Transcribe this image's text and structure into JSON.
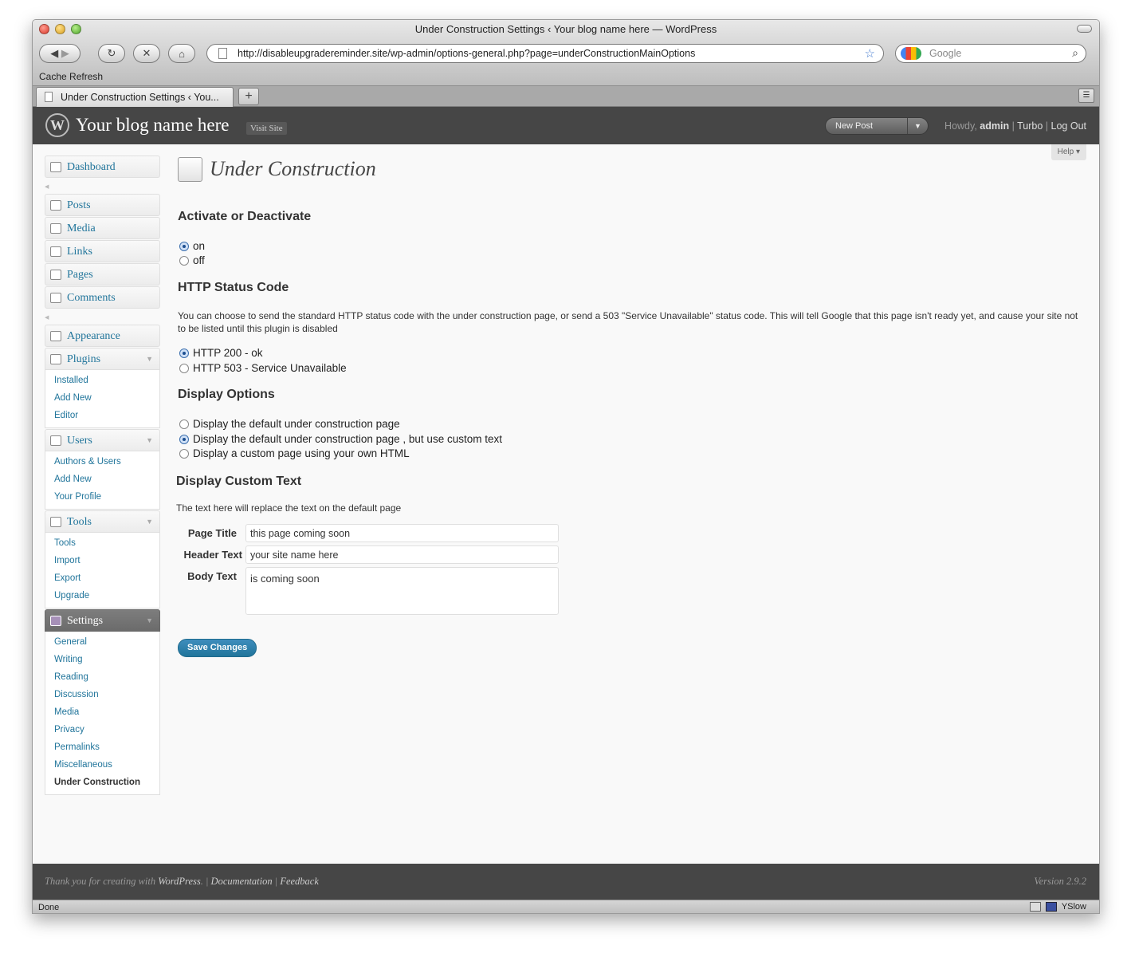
{
  "browser": {
    "window_title": "Under Construction Settings ‹ Your blog name here — WordPress",
    "url": "http://disableupgradereminder.site/wp-admin/options-general.php?page=underConstructionMainOptions",
    "search_placeholder": "Google",
    "bookmark": "Cache Refresh",
    "tab_title": "Under Construction Settings ‹ You...",
    "status": "Done",
    "status_ext": "YSlow"
  },
  "header": {
    "blog_name": "Your blog name here",
    "visit_site": "Visit Site",
    "new_post": "New Post",
    "howdy": "Howdy,",
    "user": "admin",
    "sep1": "|",
    "turbo": "Turbo",
    "sep2": "|",
    "logout": "Log Out",
    "help": "Help"
  },
  "menu": {
    "dashboard": "Dashboard",
    "posts": "Posts",
    "media": "Media",
    "links": "Links",
    "pages": "Pages",
    "comments": "Comments",
    "appearance": "Appearance",
    "plugins": "Plugins",
    "plugins_sub": [
      "Installed",
      "Add New",
      "Editor"
    ],
    "users": "Users",
    "users_sub": [
      "Authors & Users",
      "Add New",
      "Your Profile"
    ],
    "tools": "Tools",
    "tools_sub": [
      "Tools",
      "Import",
      "Export",
      "Upgrade"
    ],
    "settings": "Settings",
    "settings_sub": [
      "General",
      "Writing",
      "Reading",
      "Discussion",
      "Media",
      "Privacy",
      "Permalinks",
      "Miscellaneous",
      "Under Construction"
    ]
  },
  "content": {
    "page_title": "Under Construction",
    "activate_heading": "Activate or Deactivate",
    "activate_on": "on",
    "activate_off": "off",
    "http_heading": "HTTP Status Code",
    "http_desc": "You can choose to send the standard HTTP status code with the under construction page, or send a 503 \"Service Unavailable\" status code. This will tell Google that this page isn't ready yet, and cause your site not to be listed until this plugin is disabled",
    "http_200": "HTTP 200 - ok",
    "http_503": "HTTP 503 - Service Unavailable",
    "display_heading": "Display Options",
    "display_opt1": "Display the default under construction page",
    "display_opt2": "Display the default under construction page , but use custom text",
    "display_opt3": "Display a custom page using your own HTML",
    "custom_heading": "Display Custom Text",
    "custom_desc": "The text here will replace the text on the default page",
    "page_title_label": "Page Title",
    "page_title_value": "this page coming soon",
    "header_text_label": "Header Text",
    "header_text_value": "your site name here",
    "body_text_label": "Body Text",
    "body_text_value": "is coming soon",
    "save_button": "Save Changes"
  },
  "footer": {
    "thank_you": "Thank you for creating with",
    "wordpress": "WordPress",
    "documentation": "Documentation",
    "feedback": "Feedback",
    "version": "Version 2.9.2"
  }
}
